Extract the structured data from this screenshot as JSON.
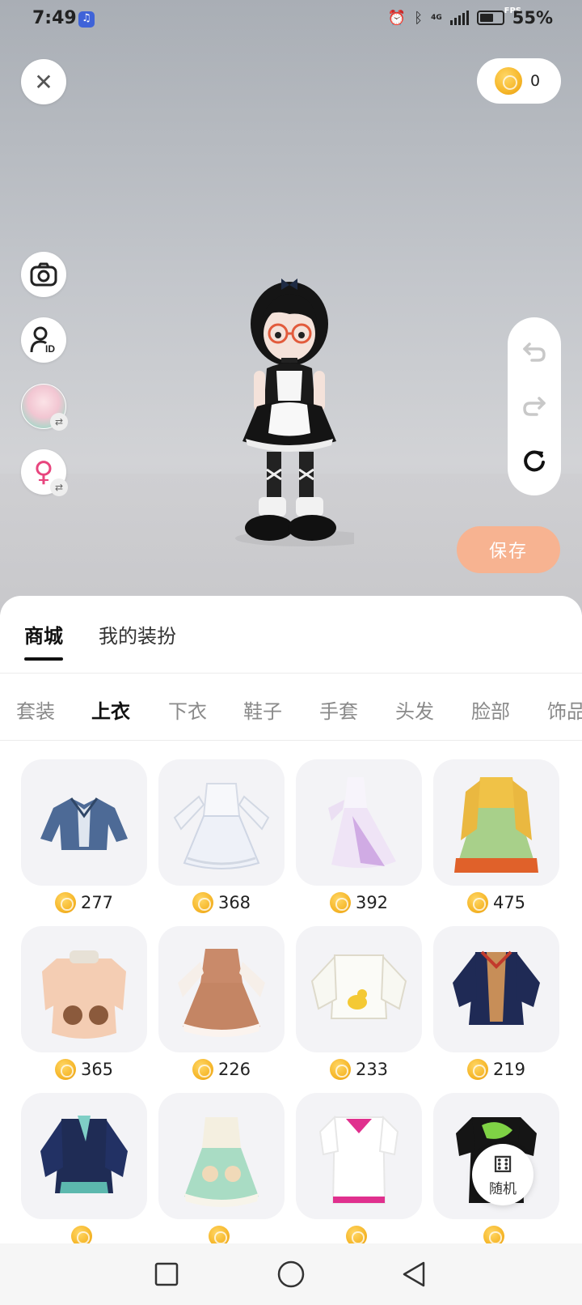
{
  "status_bar": {
    "time": "7:49",
    "network": "4G",
    "battery": "55%",
    "fps_label": "FPS"
  },
  "viewer": {
    "coin_balance": "0",
    "save_label": "保存"
  },
  "main_tabs": [
    {
      "label": "商城",
      "active": true
    },
    {
      "label": "我的装扮",
      "active": false
    }
  ],
  "category_tabs": [
    {
      "label": "套装",
      "active": false
    },
    {
      "label": "上衣",
      "active": true
    },
    {
      "label": "下衣",
      "active": false
    },
    {
      "label": "鞋子",
      "active": false
    },
    {
      "label": "手套",
      "active": false
    },
    {
      "label": "头发",
      "active": false
    },
    {
      "label": "脸部",
      "active": false
    },
    {
      "label": "饰品",
      "active": false
    }
  ],
  "items": [
    {
      "price": "277",
      "icon": "denim-jacket"
    },
    {
      "price": "368",
      "icon": "white-lolita-dress"
    },
    {
      "price": "392",
      "icon": "lilac-gown"
    },
    {
      "price": "475",
      "icon": "hanfu-robe"
    },
    {
      "price": "365",
      "icon": "bear-coat"
    },
    {
      "price": "226",
      "icon": "brown-dress"
    },
    {
      "price": "233",
      "icon": "duck-sweater"
    },
    {
      "price": "219",
      "icon": "navy-coat"
    },
    {
      "price": "",
      "icon": "teal-jacket"
    },
    {
      "price": "",
      "icon": "mint-dress"
    },
    {
      "price": "",
      "icon": "pink-shirt"
    },
    {
      "price": "",
      "icon": "graffiti-shirt"
    }
  ],
  "random_button": {
    "label": "随机",
    "icon": "dice-icon"
  },
  "colors": {
    "accent": "#f7b391",
    "coin": "#f6b72a"
  }
}
